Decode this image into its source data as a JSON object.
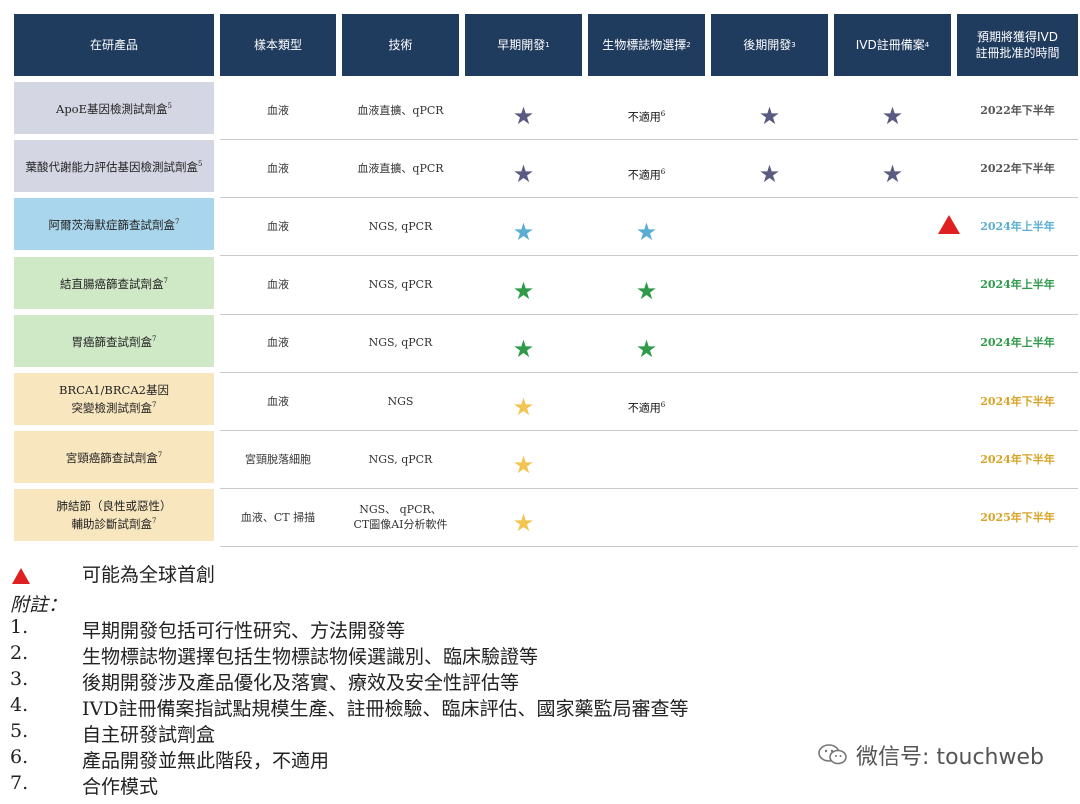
{
  "colors": {
    "header_bg": "#1f3b5e",
    "purple_star": "#5a5b80",
    "blue_star": "#5aaed3",
    "green_star": "#2f9a4a",
    "yellow_star": "#f2c451",
    "triangle": "#e02020"
  },
  "header": {
    "product": "在研產品",
    "sample": "樣本類型",
    "tech": "技術",
    "early": "早期開發",
    "early_sup": "1",
    "biomarker": "生物標誌物選擇",
    "biomarker_sup": "2",
    "late": "後期開發",
    "late_sup": "3",
    "ivd": "IVD註冊備案",
    "ivd_sup": "4",
    "expected_1": "預期將獲得IVD",
    "expected_2": "註冊批准的時間"
  },
  "rows": [
    {
      "product": "ApoE基因檢測試劑盒",
      "sup": "5",
      "sample": "血液",
      "tech": "血液直擴、qPCR",
      "early": "★",
      "biomarker": "不適用",
      "biomarker_sup": "6",
      "late": "★",
      "ivd": "★",
      "time": "2022年下半年",
      "bg": "#d5d6e4",
      "star_color": "#5a5b80",
      "time_color": "#555555"
    },
    {
      "product": "葉酸代謝能力評估基因檢測試劑盒",
      "sup": "5",
      "sample": "血液",
      "tech": "血液直擴、qPCR",
      "early": "★",
      "biomarker": "不適用",
      "biomarker_sup": "6",
      "late": "★",
      "ivd": "★",
      "time": "2022年下半年",
      "bg": "#d5d6e4",
      "star_color": "#5a5b80",
      "time_color": "#555555"
    },
    {
      "product": "阿爾茨海默症篩查試劑盒",
      "sup": "7",
      "sample": "血液",
      "tech": "NGS, qPCR",
      "early": "★",
      "biomarker": "★",
      "time": "2024年上半年",
      "bg": "#a9d6ec",
      "star_color": "#5aaed3",
      "time_color": "#5aaed3"
    },
    {
      "product": "結直腸癌篩查試劑盒",
      "sup": "7",
      "sample": "血液",
      "tech": "NGS, qPCR",
      "early": "★",
      "biomarker": "★",
      "time": "2024年上半年",
      "bg": "#cfe8c6",
      "star_color": "#2f9a4a",
      "time_color": "#2f9a4a"
    },
    {
      "product": "胃癌篩查試劑盒",
      "sup": "7",
      "sample": "血液",
      "tech": "NGS, qPCR",
      "early": "★",
      "biomarker": "★",
      "time": "2024年上半年",
      "bg": "#cfe8c6",
      "star_color": "#2f9a4a",
      "time_color": "#2f9a4a"
    },
    {
      "product": "BRCA1/BRCA2基因",
      "product_2": "突變檢測試劑盒",
      "sup": "7",
      "sample": "血液",
      "tech": "NGS",
      "early": "★",
      "biomarker": "不適用",
      "biomarker_sup": "6",
      "time": "2024年下半年",
      "bg": "#f8e6bf",
      "star_color": "#f2c451",
      "time_color": "#d8a427"
    },
    {
      "product": "宮頸癌篩查試劑盒",
      "sup": "7",
      "sample": "宮頸脫落細胞",
      "tech": "NGS, qPCR",
      "early": "★",
      "time": "2024年下半年",
      "bg": "#f8e6bf",
      "star_color": "#f2c451",
      "time_color": "#d8a427"
    },
    {
      "product": "肺結節（良性或惡性）",
      "product_2": "輔助診斷試劑盒",
      "sup": "7",
      "sample": "血液、CT 掃描",
      "tech": "NGS、 qPCR、",
      "tech_2": "CT圖像AI分析軟件",
      "early": "★",
      "time": "2025年下半年",
      "bg": "#f8e6bf",
      "star_color": "#f2c451",
      "time_color": "#d8a427"
    }
  ],
  "legend": "可能為全球首創",
  "notes_title": "附註：",
  "notes": [
    {
      "num": "1.",
      "text": "早期開發包括可行性研究、方法開發等"
    },
    {
      "num": "2.",
      "text": "生物標誌物選擇包括生物標誌物候選識別、臨床驗證等"
    },
    {
      "num": "3.",
      "text": "後期開發涉及產品優化及落實、療效及安全性評估等"
    },
    {
      "num": "4.",
      "text": "IVD註冊備案指試點規模生產、註冊檢驗、臨床評估、國家藥監局審查等"
    },
    {
      "num": "5.",
      "text": "自主研發試劑盒"
    },
    {
      "num": "6.",
      "text": "產品開發並無此階段，不適用"
    },
    {
      "num": "7.",
      "text": "合作模式"
    }
  ],
  "watermark": "微信号: touchweb",
  "watermark_icon": "wechat-icon"
}
